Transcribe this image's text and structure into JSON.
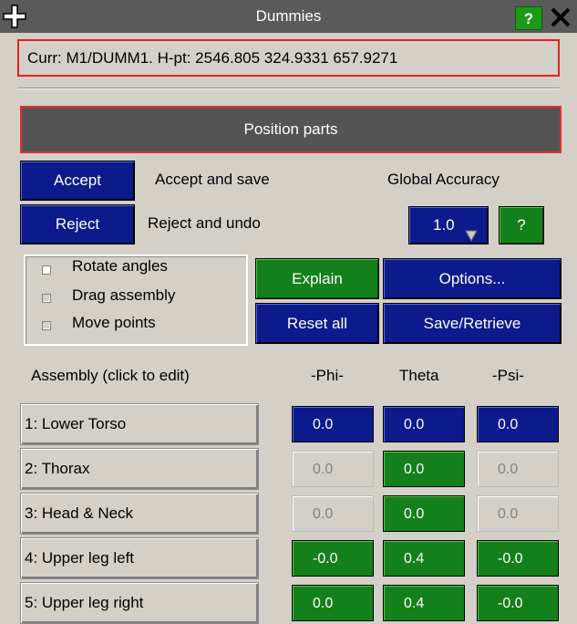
{
  "window": {
    "title": "Dummies",
    "help_label": "?"
  },
  "status": {
    "text": "Curr: M1/DUMM1. H-pt: 2546.805  324.9331  657.9271"
  },
  "header": {
    "position_parts": "Position parts"
  },
  "actions": {
    "accept_label": "Accept",
    "accept_desc": "Accept and save",
    "reject_label": "Reject",
    "reject_desc": "Reject and undo",
    "global_accuracy_label": "Global Accuracy",
    "accuracy_value": "1.0",
    "accuracy_help": "?"
  },
  "modes": {
    "items": [
      {
        "label": "Rotate angles",
        "selected": true
      },
      {
        "label": "Drag assembly",
        "selected": false
      },
      {
        "label": "Move points",
        "selected": false
      }
    ]
  },
  "buttons": {
    "explain": "Explain",
    "options": "Options...",
    "reset_all": "Reset all",
    "save_retrieve": "Save/Retrieve"
  },
  "table": {
    "assembly_header": "Assembly (click to edit)",
    "col_phi": "-Phi-",
    "col_theta": "Theta",
    "col_psi": "-Psi-",
    "rows": [
      {
        "name": "1: Lower Torso",
        "phi": "0.0",
        "theta": "0.0",
        "psi": "0.0",
        "phi_state": "blue",
        "theta_state": "blue",
        "psi_state": "blue"
      },
      {
        "name": "2: Thorax",
        "phi": "0.0",
        "theta": "0.0",
        "psi": "0.0",
        "phi_state": "grey",
        "theta_state": "green",
        "psi_state": "grey"
      },
      {
        "name": "3: Head & Neck",
        "phi": "0.0",
        "theta": "0.0",
        "psi": "0.0",
        "phi_state": "grey",
        "theta_state": "green",
        "psi_state": "grey"
      },
      {
        "name": "4: Upper leg left",
        "phi": "-0.0",
        "theta": "0.4",
        "psi": "-0.0",
        "phi_state": "green",
        "theta_state": "green",
        "psi_state": "green"
      },
      {
        "name": "5: Upper leg right",
        "phi": "0.0",
        "theta": "0.4",
        "psi": "-0.0",
        "phi_state": "green",
        "theta_state": "green",
        "psi_state": "green"
      }
    ]
  },
  "colors": {
    "button_blue": "#0c1a8c",
    "button_green": "#14801c",
    "highlight_red": "#e02020",
    "panel_grey": "#d4d0c8",
    "title_grey": "#5a5a5a"
  },
  "icons": {
    "move": "move-icon",
    "close": "close-icon",
    "dropdown": "dropdown-arrow-icon"
  }
}
